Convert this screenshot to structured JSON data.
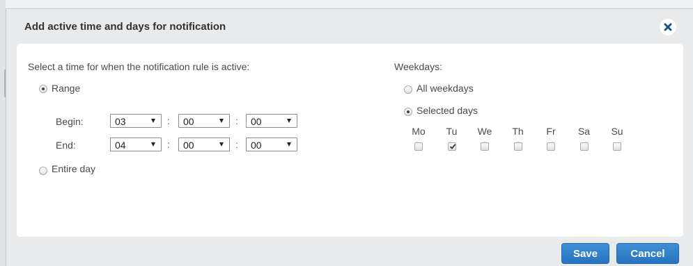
{
  "dialog": {
    "title": "Add active time and days for notification",
    "close_icon": "close-icon"
  },
  "time_section": {
    "prompt": "Select a time for when the notification rule is active:",
    "range_label": "Range",
    "range_selected": true,
    "begin_label": "Begin:",
    "end_label": "End:",
    "colon": ":",
    "begin": {
      "hour": "03",
      "minute": "00",
      "second": "00"
    },
    "end": {
      "hour": "04",
      "minute": "00",
      "second": "00"
    },
    "entire_day_label": "Entire day",
    "entire_day_selected": false
  },
  "weekdays_section": {
    "heading": "Weekdays:",
    "all_weekdays_label": "All weekdays",
    "all_weekdays_selected": false,
    "selected_days_label": "Selected days",
    "selected_days_selected": true,
    "days": [
      {
        "label": "Mo",
        "checked": false
      },
      {
        "label": "Tu",
        "checked": true
      },
      {
        "label": "We",
        "checked": false
      },
      {
        "label": "Th",
        "checked": false
      },
      {
        "label": "Fr",
        "checked": false
      },
      {
        "label": "Sa",
        "checked": false
      },
      {
        "label": "Su",
        "checked": false
      }
    ]
  },
  "footer": {
    "save_label": "Save",
    "cancel_label": "Cancel"
  },
  "colors": {
    "primary_button": "#2f7fca",
    "dialog_background": "#e8eaec",
    "content_background": "#ffffff"
  }
}
